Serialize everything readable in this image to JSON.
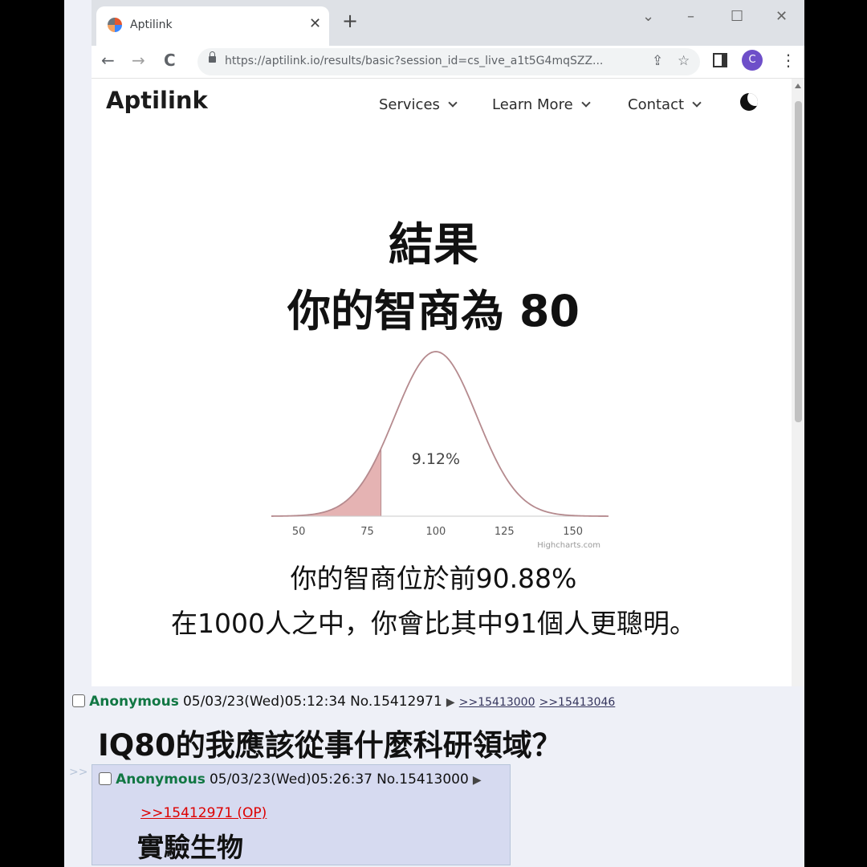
{
  "browser": {
    "tab_title": "Aptilink",
    "url": "https://aptilink.io/results/basic?session_id=cs_live_a1t5G4mqSZZ...",
    "profile_initial": "C",
    "window_controls": {
      "minimize": "–",
      "maximize": "☐",
      "close": "✕",
      "dropdown": "⌄"
    },
    "nav_icons": {
      "back": "←",
      "forward": "→",
      "reload": "C"
    }
  },
  "site": {
    "logo": "Aptilink",
    "nav": [
      {
        "label": "Services"
      },
      {
        "label": "Learn More"
      },
      {
        "label": "Contact"
      }
    ]
  },
  "result": {
    "heading": "結果",
    "iq_line": "你的智商為 80",
    "percentile_line": "你的智商位於前90.88%",
    "comparison_line": "在1000人之中，你會比其中91個人更聰明。"
  },
  "chart_data": {
    "type": "area",
    "description_note": "",
    "x_ticks": [
      50,
      75,
      100,
      125,
      150
    ],
    "xlim": [
      40,
      163
    ],
    "mean": 100,
    "sd": 15,
    "shaded_upto": 80,
    "shaded_label": "9.12%",
    "credit": "Highcharts.com",
    "colors": {
      "curve": "#b58a8e",
      "shade": "#e5b3b3",
      "axis": "#c9c9c9"
    }
  },
  "forum": {
    "op": {
      "name": "Anonymous",
      "datetime": "05/03/23(Wed)05:12:34",
      "number": "No.15412971",
      "replies": [
        ">>15413000",
        ">>15413046"
      ],
      "text": "IQ80的我應該從事什麼科研領域？"
    },
    "reply": {
      "marker": ">>",
      "name": "Anonymous",
      "datetime": "05/03/23(Wed)05:26:37",
      "number": "No.15413000",
      "quote": ">>15412971 (OP)",
      "text": "實驗生物"
    }
  }
}
